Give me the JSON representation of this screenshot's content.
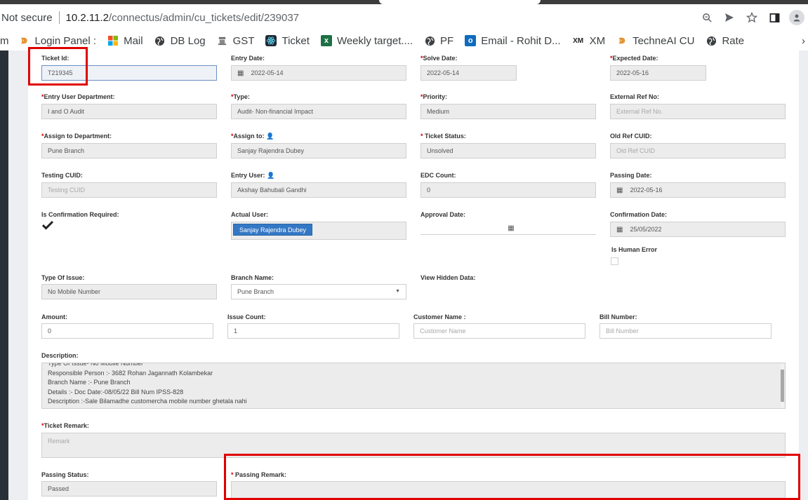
{
  "browser": {
    "security_label": "Not secure",
    "url_host": "10.2.11.2",
    "url_path": "/connectus/admin/cu_tickets/edit/239037",
    "bookmarks": [
      {
        "label": "m",
        "icon": ""
      },
      {
        "label": "Login Panel :",
        "icon": "bank-logo-icon"
      },
      {
        "label": "Mail",
        "icon": "windows-logo-icon"
      },
      {
        "label": "DB Log",
        "icon": "globe-icon"
      },
      {
        "label": "GST",
        "icon": "emblem-icon"
      },
      {
        "label": "Ticket",
        "icon": "react-logo-icon"
      },
      {
        "label": "Weekly target....",
        "icon": "excel-icon"
      },
      {
        "label": "PF",
        "icon": "globe-icon"
      },
      {
        "label": "Email - Rohit D...",
        "icon": "outlook-icon"
      },
      {
        "label": "XM",
        "icon": "xm-logo-icon"
      },
      {
        "label": "TechneAI CU",
        "icon": "bank-logo-icon"
      },
      {
        "label": "Rate",
        "icon": "globe-icon"
      }
    ],
    "more": "›"
  },
  "form": {
    "ticket_id": {
      "label": "Ticket Id:",
      "value": "T219345"
    },
    "entry_date": {
      "label": "Entry Date:",
      "value": "2022-05-14"
    },
    "solve_date": {
      "label": "Solve Date:",
      "value": "2022-05-14"
    },
    "expected_date": {
      "label": "Expected Date:",
      "value": "2022-05-16"
    },
    "entry_user_department": {
      "label": "Entry User Department:",
      "value": "I and O Audit"
    },
    "type": {
      "label": "Type:",
      "value": "Audit- Non-financial Impact"
    },
    "priority": {
      "label": "Priority:",
      "value": "Medium"
    },
    "external_ref_no": {
      "label": "External Ref No:",
      "placeholder": "External Ref No."
    },
    "assign_to_department": {
      "label": "Assign to Department:",
      "value": "Pune Branch"
    },
    "assign_to": {
      "label": "Assign to:",
      "value": "Sanjay Rajendra Dubey"
    },
    "ticket_status": {
      "label": " Ticket Status:",
      "value": "Unsolved"
    },
    "old_ref_cuid": {
      "label": "Old Ref CUID:",
      "placeholder": "Old Ref CUID"
    },
    "testing_cuid": {
      "label": "Testing CUID:",
      "placeholder": "Testing CUID"
    },
    "entry_user": {
      "label": "Entry User:",
      "value": "Akshay Bahubali Gandhi"
    },
    "edc_count": {
      "label": "EDC Count:",
      "value": "0"
    },
    "passing_date": {
      "label": "Passing Date:",
      "value": "2022-05-16"
    },
    "is_confirmation_required": {
      "label": "Is Confirmation Required:"
    },
    "actual_user": {
      "label": "Actual User:",
      "value": "Sanjay Rajendra Dubey"
    },
    "approval_date": {
      "label": "Approval Date:"
    },
    "confirmation_date": {
      "label": "Confirmation Date:",
      "value": "25/05/2022"
    },
    "is_human_error": {
      "label": "Is Human Error"
    },
    "type_of_issue": {
      "label": "Type Of Issue:",
      "value": "No Mobile Number"
    },
    "branch_name": {
      "label": "Branch Name:",
      "value": "Pune Branch"
    },
    "view_hidden_data": {
      "label": "View Hidden Data:"
    },
    "amount": {
      "label": "Amount:",
      "value": "0"
    },
    "issue_count": {
      "label": "Issue Count:",
      "value": "1"
    },
    "customer_name": {
      "label": "Customer Name :",
      "placeholder": "Customer Name"
    },
    "bill_number": {
      "label": "Bill Number:",
      "placeholder": "Bill Number"
    },
    "description": {
      "label": "Description:",
      "lines": [
        "Type Of Issue- No Mobile Number",
        "Responsible Person :- 3682 Rohan Jagannath Kolambekar",
        "Branch Name :- Pune Branch",
        "Details :-  Doc Date:-08/05/22 Bill Num IPSS-828",
        "Description :-Sale Bilamadhe customercha mobile number ghetala nahi"
      ]
    },
    "ticket_remark": {
      "label": "Ticket Remark:",
      "placeholder": "Remark"
    },
    "passing_status": {
      "label": "Passing Status:",
      "value": "Passed"
    },
    "passing_remark": {
      "label": " Passing Remark:"
    },
    "required_mark": "*"
  }
}
